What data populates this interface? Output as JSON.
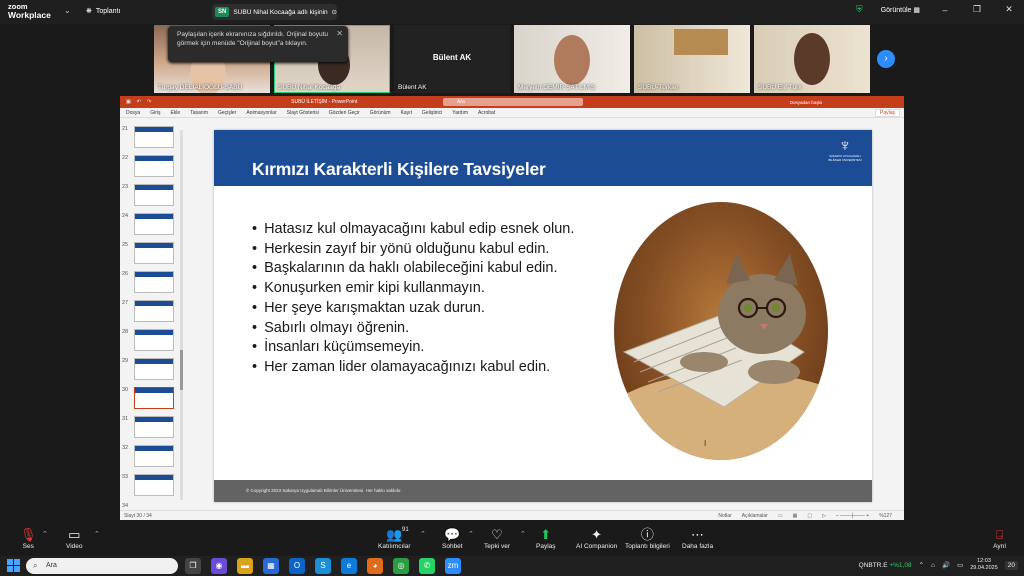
{
  "zoom": {
    "logo_line1": "zoom",
    "logo_line2": "Workplace",
    "meeting_label": "Toplantı",
    "share_badge": "SN",
    "share_text": "SUBÜ Nihal Kocaağa adlı kişinin ekranı",
    "view_label": "Görüntüle"
  },
  "tooltip": {
    "text": "Paylaşılan içerik ekranınıza sığdırıldı. Orijinal boyutu görmek için menüde \"Orijinal boyut\"a tıklayın."
  },
  "participants": [
    {
      "name": "Turgay DELİALİOĞLU-SABÜ"
    },
    {
      "name": "SUBÜ Nihal Kocaağa"
    },
    {
      "name": "Bülent AK",
      "center": "Bülent AK"
    },
    {
      "name": "Meryem DEMİR SATILMIŞ"
    },
    {
      "name": "SUBÜ-Türkan"
    },
    {
      "name": "SUBÜ Elif Türk"
    }
  ],
  "ppt": {
    "file_name": "SUBÜ İLETİŞİM  -  PowerPoint",
    "search_placeholder": "Ara",
    "menu": [
      "Dosya",
      "Giriş",
      "Ekle",
      "Tasarım",
      "Geçişler",
      "Animasyonlar",
      "Slayt Gösterisi",
      "Gözden Geçir",
      "Görünüm",
      "Kayıt",
      "Geliştirici",
      "Yardım",
      "Acrobat"
    ],
    "share": "Paylaş",
    "present": "Dosyadan başla",
    "thumb_numbers": [
      "21",
      "22",
      "23",
      "24",
      "25",
      "26",
      "27",
      "28",
      "29",
      "30",
      "31",
      "32",
      "33",
      "34"
    ],
    "status_left": "Slayt 30 / 34",
    "status_notes": "Notlar",
    "status_comments": "Açıklamalar",
    "zoom_level": "%127"
  },
  "slide": {
    "title": "Kırmızı Karakterli Kişilere Tavsiyeler",
    "logo_text": "SAKARYA UYGULAMALI BİLİMLER ÜNİVERSİTESİ",
    "bullets": [
      "Hatasız kul olmayacağını kabul edip esnek olun.",
      "Herkesin zayıf bir yönü olduğunu kabul edin.",
      "Başkalarının da haklı olabileceğini kabul edin.",
      "Konuşurken emir kipi kullanmayın.",
      "Her şeye karışmaktan uzak durun.",
      "Sabırlı olmayı öğrenin.",
      "İnsanları küçümsemeyin.",
      "Her zaman lider olamayacağınızı kabul edin."
    ],
    "footer": "© Copyright 2023 Sakarya Uygulamalı Bilimler Üniversitesi. Her hakkı saklıdır."
  },
  "controls": {
    "ses": "Ses",
    "video": "Video",
    "katilimcilar": "Katılımcılar",
    "participant_count": "91",
    "sohbet": "Sohbet",
    "tepki": "Tepki ver",
    "paylas": "Paylaş",
    "ai": "AI Companion",
    "bilgi": "Toplantı bilgileri",
    "daha": "Daha fazla",
    "ayril": "Ayrıl"
  },
  "taskbar": {
    "search_placeholder": "Ara",
    "ticker_symbol": "QNBTR.E",
    "ticker_change": "+%1,08",
    "time": "12:03",
    "date": "29.04.2025",
    "notif_count": "20"
  }
}
